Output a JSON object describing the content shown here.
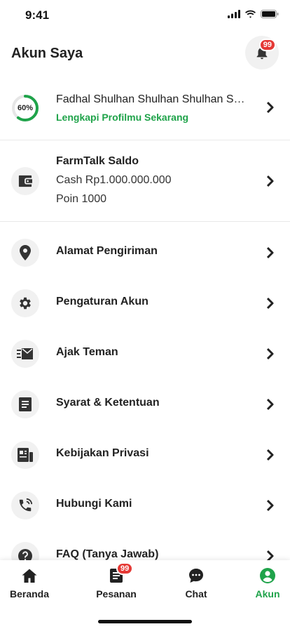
{
  "status_bar": {
    "time": "9:41"
  },
  "header": {
    "title": "Akun Saya",
    "notification_count": "99"
  },
  "profile": {
    "progress_label": "60%",
    "progress_fraction": 0.6,
    "name": "Fadhal Shulhan Shulhan Shulhan Shulhan Shulhan",
    "link": "Lengkapi Profilmu Sekarang"
  },
  "saldo": {
    "title": "FarmTalk Saldo",
    "cash": "Cash Rp1.000.000.000",
    "poin": "Poin 1000"
  },
  "menu": {
    "items": [
      {
        "label": "Alamat Pengiriman",
        "icon": "location-pin-icon"
      },
      {
        "label": "Pengaturan Akun",
        "icon": "gear-icon"
      },
      {
        "label": "Ajak Teman",
        "icon": "mail-send-icon"
      },
      {
        "label": "Syarat & Ketentuan",
        "icon": "document-icon"
      },
      {
        "label": "Kebijakan Privasi",
        "icon": "policy-icon"
      },
      {
        "label": "Hubungi Kami",
        "icon": "phone-call-icon"
      },
      {
        "label": "FAQ (Tanya Jawab)",
        "icon": "help-icon"
      }
    ]
  },
  "bottom_nav": {
    "items": [
      {
        "label": "Beranda",
        "icon": "home-icon"
      },
      {
        "label": "Pesanan",
        "icon": "orders-icon",
        "badge": "99"
      },
      {
        "label": "Chat",
        "icon": "chat-icon"
      },
      {
        "label": "Akun",
        "icon": "account-icon",
        "active": true
      }
    ]
  },
  "colors": {
    "accent": "#1fa34a",
    "badge": "#e53935",
    "icon_bg": "#f1f1f1"
  }
}
